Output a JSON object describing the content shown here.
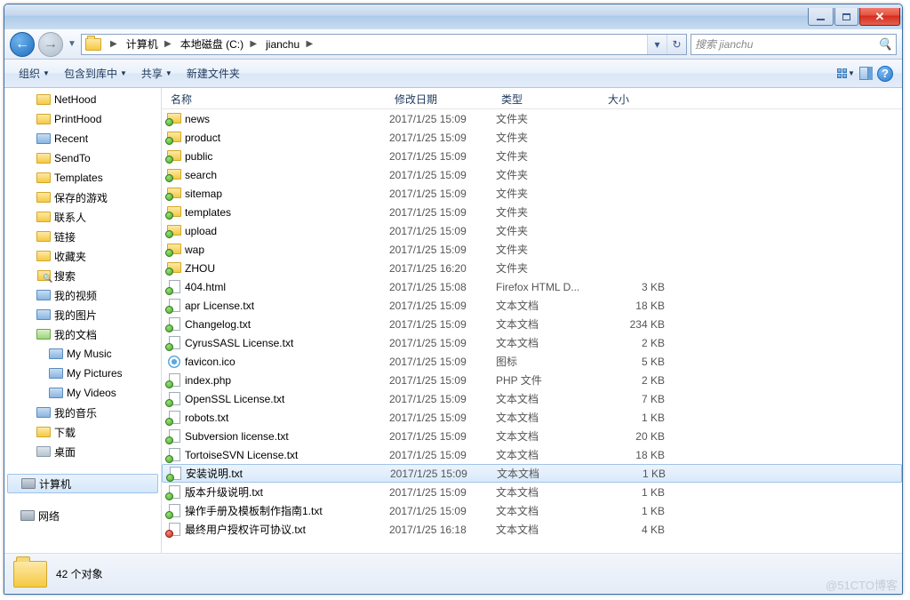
{
  "breadcrumbs": [
    "计算机",
    "本地磁盘 (C:)",
    "jianchu"
  ],
  "search_placeholder": "搜索 jianchu",
  "toolbar": {
    "organize": "组织",
    "include": "包含到库中",
    "share": "共享",
    "newfolder": "新建文件夹"
  },
  "columns": {
    "name": "名称",
    "date": "修改日期",
    "type": "类型",
    "size": "大小"
  },
  "sidebar": [
    {
      "label": "NetHood",
      "icon": "fld-y",
      "indent": 1
    },
    {
      "label": "PrintHood",
      "icon": "fld-y",
      "indent": 1
    },
    {
      "label": "Recent",
      "icon": "fld-b",
      "indent": 1
    },
    {
      "label": "SendTo",
      "icon": "fld-y",
      "indent": 1
    },
    {
      "label": "Templates",
      "icon": "fld-y",
      "indent": 1
    },
    {
      "label": "保存的游戏",
      "icon": "fld-y",
      "indent": 1
    },
    {
      "label": "联系人",
      "icon": "fld-y",
      "indent": 1
    },
    {
      "label": "链接",
      "icon": "fld-y",
      "indent": 1
    },
    {
      "label": "收藏夹",
      "icon": "fld-y",
      "indent": 1
    },
    {
      "label": "搜索",
      "icon": "srchfld",
      "indent": 1
    },
    {
      "label": "我的视频",
      "icon": "fld-b",
      "indent": 1
    },
    {
      "label": "我的图片",
      "icon": "fld-b",
      "indent": 1
    },
    {
      "label": "我的文档",
      "icon": "fld-g",
      "indent": 1
    },
    {
      "label": "My Music",
      "icon": "fld-b",
      "indent": 2
    },
    {
      "label": "My Pictures",
      "icon": "fld-b",
      "indent": 2
    },
    {
      "label": "My Videos",
      "icon": "fld-b",
      "indent": 2
    },
    {
      "label": "我的音乐",
      "icon": "fld-b",
      "indent": 1
    },
    {
      "label": "下载",
      "icon": "fld-y",
      "indent": 1
    },
    {
      "label": "桌面",
      "icon": "fld-c",
      "indent": 1
    }
  ],
  "sidebar_computer": "计算机",
  "sidebar_network": "网络",
  "files": [
    {
      "name": "news",
      "date": "2017/1/25 15:09",
      "type": "文件夹",
      "size": "",
      "icon": "folder"
    },
    {
      "name": "product",
      "date": "2017/1/25 15:09",
      "type": "文件夹",
      "size": "",
      "icon": "folder"
    },
    {
      "name": "public",
      "date": "2017/1/25 15:09",
      "type": "文件夹",
      "size": "",
      "icon": "folder"
    },
    {
      "name": "search",
      "date": "2017/1/25 15:09",
      "type": "文件夹",
      "size": "",
      "icon": "folder"
    },
    {
      "name": "sitemap",
      "date": "2017/1/25 15:09",
      "type": "文件夹",
      "size": "",
      "icon": "folder"
    },
    {
      "name": "templates",
      "date": "2017/1/25 15:09",
      "type": "文件夹",
      "size": "",
      "icon": "folder"
    },
    {
      "name": "upload",
      "date": "2017/1/25 15:09",
      "type": "文件夹",
      "size": "",
      "icon": "folder"
    },
    {
      "name": "wap",
      "date": "2017/1/25 15:09",
      "type": "文件夹",
      "size": "",
      "icon": "folder"
    },
    {
      "name": "ZHOU",
      "date": "2017/1/25 16:20",
      "type": "文件夹",
      "size": "",
      "icon": "folder"
    },
    {
      "name": "404.html",
      "date": "2017/1/25 15:08",
      "type": "Firefox HTML D...",
      "size": "3 KB",
      "icon": "file"
    },
    {
      "name": "apr License.txt",
      "date": "2017/1/25 15:09",
      "type": "文本文档",
      "size": "18 KB",
      "icon": "file"
    },
    {
      "name": "Changelog.txt",
      "date": "2017/1/25 15:09",
      "type": "文本文档",
      "size": "234 KB",
      "icon": "file"
    },
    {
      "name": "CyrusSASL License.txt",
      "date": "2017/1/25 15:09",
      "type": "文本文档",
      "size": "2 KB",
      "icon": "file"
    },
    {
      "name": "favicon.ico",
      "date": "2017/1/25 15:09",
      "type": "图标",
      "size": "5 KB",
      "icon": "favicon"
    },
    {
      "name": "index.php",
      "date": "2017/1/25 15:09",
      "type": "PHP 文件",
      "size": "2 KB",
      "icon": "file"
    },
    {
      "name": "OpenSSL License.txt",
      "date": "2017/1/25 15:09",
      "type": "文本文档",
      "size": "7 KB",
      "icon": "file"
    },
    {
      "name": "robots.txt",
      "date": "2017/1/25 15:09",
      "type": "文本文档",
      "size": "1 KB",
      "icon": "file"
    },
    {
      "name": "Subversion license.txt",
      "date": "2017/1/25 15:09",
      "type": "文本文档",
      "size": "20 KB",
      "icon": "file"
    },
    {
      "name": "TortoiseSVN License.txt",
      "date": "2017/1/25 15:09",
      "type": "文本文档",
      "size": "18 KB",
      "icon": "file"
    },
    {
      "name": "安装说明.txt",
      "date": "2017/1/25 15:09",
      "type": "文本文档",
      "size": "1 KB",
      "icon": "file",
      "selected": true
    },
    {
      "name": "版本升级说明.txt",
      "date": "2017/1/25 15:09",
      "type": "文本文档",
      "size": "1 KB",
      "icon": "file"
    },
    {
      "name": "操作手册及模板制作指南1.txt",
      "date": "2017/1/25 15:09",
      "type": "文本文档",
      "size": "1 KB",
      "icon": "file"
    },
    {
      "name": "最终用户授权许可协议.txt",
      "date": "2017/1/25 16:18",
      "type": "文本文档",
      "size": "4 KB",
      "icon": "file-red"
    }
  ],
  "status": "42 个对象",
  "watermark": "@51CTO博客"
}
